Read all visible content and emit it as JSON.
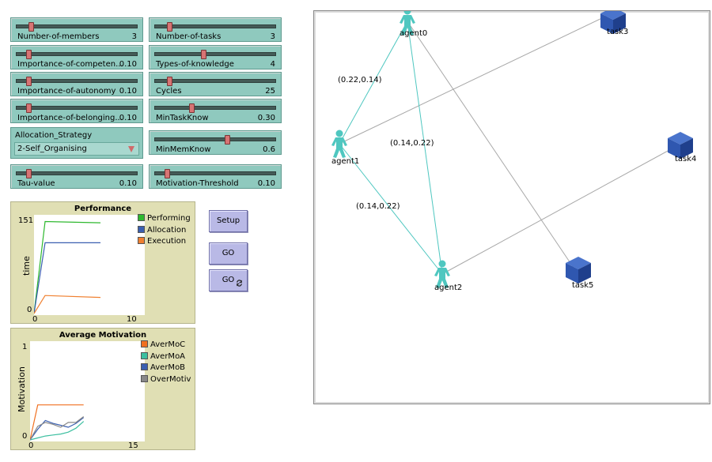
{
  "sliders": [
    {
      "id": "number-of-members",
      "label": "Number-of-members",
      "value": "3",
      "pos": 0.12
    },
    {
      "id": "number-of-tasks",
      "label": "Number-of-tasks",
      "value": "3",
      "pos": 0.12
    },
    {
      "id": "importance-of-competence",
      "label": "Importance-of-competen...",
      "value": "0.10",
      "pos": 0.1
    },
    {
      "id": "types-of-knowledge",
      "label": "Types-of-knowledge",
      "value": "4",
      "pos": 0.4
    },
    {
      "id": "importance-of-autonomy",
      "label": "Importance-of-autonomy",
      "value": "0.10",
      "pos": 0.1
    },
    {
      "id": "cycles",
      "label": "Cycles",
      "value": "25",
      "pos": 0.12
    },
    {
      "id": "importance-of-belonging",
      "label": "Importance-of-belonging...",
      "value": "0.10",
      "pos": 0.1
    },
    {
      "id": "min-task-know",
      "label": "MinTaskKnow",
      "value": "0.30",
      "pos": 0.3
    },
    {
      "id": "min-mem-know",
      "label": "MinMemKnow",
      "value": "0.6",
      "pos": 0.6
    },
    {
      "id": "tau-value",
      "label": "Tau-value",
      "value": "0.10",
      "pos": 0.1
    },
    {
      "id": "motivation-threshold",
      "label": "Motivation-Threshold",
      "value": "0.10",
      "pos": 0.1
    }
  ],
  "chooser": {
    "label": "Allocation_Strategy",
    "value": "2-Self_Organising"
  },
  "buttons": {
    "setup": "Setup",
    "go": "GO",
    "go_forever": "GO"
  },
  "performance_plot": {
    "title": "Performance",
    "ylabel": "time",
    "y_max_label": "151",
    "y_min_label": "0",
    "x_min_label": "0",
    "x_max_label": "10",
    "legend": [
      {
        "name": "Performing",
        "color": "#2eb82e"
      },
      {
        "name": "Allocation",
        "color": "#3a5fb0"
      },
      {
        "name": "Execution",
        "color": "#f08030"
      }
    ]
  },
  "motivation_plot": {
    "title": "Average Motivation",
    "ylabel": "Motivation",
    "y_max_label": "1",
    "y_min_label": "0",
    "x_min_label": "0",
    "x_max_label": "15",
    "legend": [
      {
        "name": "AverMoC",
        "color": "#f07020"
      },
      {
        "name": "AverMoA",
        "color": "#3cbfa0"
      },
      {
        "name": "AverMoB",
        "color": "#3a5fb0"
      },
      {
        "name": "OverMotiv",
        "color": "#888888"
      }
    ]
  },
  "chart_data": [
    {
      "type": "line",
      "title": "Performance",
      "xlabel": "",
      "ylabel": "time",
      "xlim": [
        0,
        10
      ],
      "ylim": [
        0,
        151
      ],
      "series": [
        {
          "name": "Performing",
          "color": "#2eb82e",
          "x": [
            0,
            1,
            6
          ],
          "y": [
            0,
            143,
            141
          ]
        },
        {
          "name": "Allocation",
          "color": "#3a5fb0",
          "x": [
            0,
            1,
            6
          ],
          "y": [
            0,
            110,
            110
          ]
        },
        {
          "name": "Execution",
          "color": "#f08030",
          "x": [
            0,
            1,
            6
          ],
          "y": [
            0,
            28,
            25
          ]
        }
      ]
    },
    {
      "type": "line",
      "title": "Average Motivation",
      "xlabel": "",
      "ylabel": "Motivation",
      "xlim": [
        0,
        15
      ],
      "ylim": [
        0,
        1
      ],
      "series": [
        {
          "name": "AverMoC",
          "color": "#f07020",
          "x": [
            0,
            1,
            2,
            3,
            4,
            5,
            6,
            7
          ],
          "y": [
            0,
            0.36,
            0.36,
            0.36,
            0.36,
            0.36,
            0.36,
            0.36
          ]
        },
        {
          "name": "AverMoA",
          "color": "#3cbfa0",
          "x": [
            0,
            1,
            2,
            3,
            4,
            5,
            6,
            7
          ],
          "y": [
            0,
            0.02,
            0.04,
            0.05,
            0.06,
            0.08,
            0.12,
            0.19
          ]
        },
        {
          "name": "AverMoB",
          "color": "#3a5fb0",
          "x": [
            0,
            1,
            2,
            3,
            4,
            5,
            6,
            7
          ],
          "y": [
            0,
            0.11,
            0.2,
            0.17,
            0.15,
            0.13,
            0.17,
            0.23
          ]
        },
        {
          "name": "OverMotiv",
          "color": "#888888",
          "x": [
            0,
            1,
            2,
            3,
            4,
            5,
            6,
            7
          ],
          "y": [
            0,
            0.14,
            0.18,
            0.16,
            0.13,
            0.18,
            0.18,
            0.24
          ]
        }
      ]
    }
  ],
  "world": {
    "agents": [
      {
        "id": "agent0",
        "label": "agent0"
      },
      {
        "id": "agent1",
        "label": "agent1"
      },
      {
        "id": "agent2",
        "label": "agent2"
      }
    ],
    "tasks": [
      {
        "id": "task3",
        "label": "task3"
      },
      {
        "id": "task4",
        "label": "task4"
      },
      {
        "id": "task5",
        "label": "task5"
      }
    ],
    "agent_color": "#4fc7c0",
    "task_color": "#2f57b0",
    "link_labels": {
      "a0_a1": "(0.22,0.14)",
      "a0_a2": "(0.14,0.22)",
      "a1_a2": "(0.14,0.22)"
    }
  }
}
